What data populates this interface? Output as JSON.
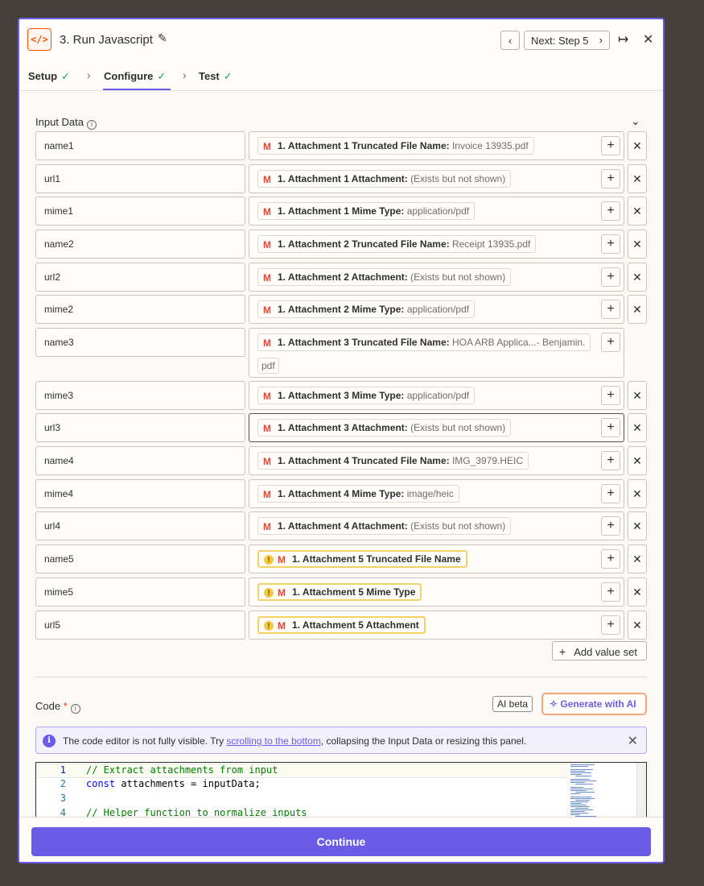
{
  "header": {
    "icon_label": "</>",
    "title": "3. Run Javascript",
    "next_label": "Next: Step 5"
  },
  "tabs": [
    {
      "label": "Setup",
      "done": true
    },
    {
      "label": "Configure",
      "done": true
    },
    {
      "label": "Test",
      "done": true
    }
  ],
  "input_data": {
    "label": "Input Data",
    "rows": [
      {
        "key": "name1",
        "field": "1. Attachment 1 Truncated File Name:",
        "value": "Invoice 13935.pdf"
      },
      {
        "key": "url1",
        "field": "1. Attachment 1 Attachment:",
        "value": "(Exists but not shown)"
      },
      {
        "key": "mime1",
        "field": "1. Attachment 1 Mime Type:",
        "value": "application/pdf"
      },
      {
        "key": "name2",
        "field": "1. Attachment 2 Truncated File Name:",
        "value": "Receipt 13935.pdf"
      },
      {
        "key": "url2",
        "field": "1. Attachment 2 Attachment:",
        "value": "(Exists but not shown)"
      },
      {
        "key": "mime2",
        "field": "1. Attachment 2 Mime Type:",
        "value": "application/pdf"
      },
      {
        "key": "name3",
        "field": "1. Attachment 3 Truncated File Name:",
        "value": "HOA ARB Applica...- Benjamin.",
        "value_cont": "pdf"
      },
      {
        "key": "mime3",
        "field": "1. Attachment 3 Mime Type:",
        "value": "application/pdf"
      },
      {
        "key": "url3",
        "field": "1. Attachment 3 Attachment:",
        "value": "(Exists but not shown)"
      },
      {
        "key": "name4",
        "field": "1. Attachment 4 Truncated File Name:",
        "value": "IMG_3979.HEIC"
      },
      {
        "key": "mime4",
        "field": "1. Attachment 4 Mime Type:",
        "value": "image/heic"
      },
      {
        "key": "url4",
        "field": "1. Attachment 4 Attachment:",
        "value": "(Exists but not shown)"
      },
      {
        "key": "name5",
        "field": "1. Attachment 5 Truncated File Name",
        "value": "",
        "warning": true
      },
      {
        "key": "mime5",
        "field": "1. Attachment 5 Mime Type",
        "value": "",
        "warning": true
      },
      {
        "key": "url5",
        "field": "1. Attachment 5 Attachment",
        "value": "",
        "warning": true
      }
    ],
    "add_value_label": "Add value set"
  },
  "code": {
    "label": "Code",
    "required_mark": "*",
    "ai_badge": "AI beta",
    "generate_label": "Generate with AI",
    "banner": {
      "prefix": "The code editor is not fully visible. Try ",
      "link": "scrolling to the bottom",
      "suffix": ", collapsing the Input Data or resizing this panel."
    },
    "lines": [
      {
        "n": "1",
        "text": "// Extract attachments from input"
      },
      {
        "n": "2",
        "text": "const attachments = inputData;"
      },
      {
        "n": "3",
        "text": ""
      },
      {
        "n": "4",
        "text": "// Helper function to normalize inputs"
      }
    ]
  },
  "footer": {
    "continue_label": "Continue"
  },
  "colors": {
    "accent": "#6b5ce7",
    "warning": "#f5c842",
    "app_icon": "#ff4f00",
    "success": "#1f9d55"
  },
  "icons": [
    "code-icon",
    "pencil-icon",
    "chevron-left-icon",
    "chevron-right-icon",
    "collapse-panel-icon",
    "close-icon",
    "check-icon",
    "info-icon",
    "chevron-down-icon",
    "gmail-icon",
    "plus-icon",
    "warning-icon",
    "sparkle-icon"
  ]
}
